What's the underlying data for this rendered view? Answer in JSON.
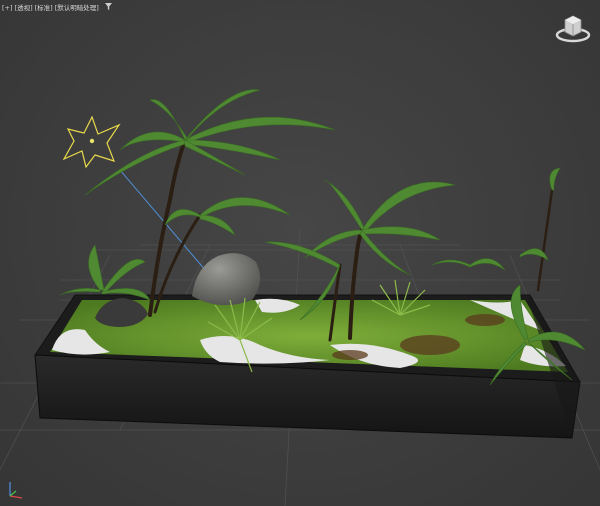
{
  "viewport": {
    "label_items": [
      "[+]",
      "[透视]",
      "[标准]",
      "[默认明暗处理]"
    ],
    "filter_icon": "funnel-icon",
    "viewcube_icon": "viewcube-home-icon",
    "axis_icon": "axis-tripod-icon",
    "scene_object": "fern-planter-model",
    "selected_light": "sun-light-helper"
  },
  "colors": {
    "viewport_bg": "#3c3c3c",
    "grid_line": "#5a5a5a",
    "light_helper": "#e8d94a",
    "light_target_line": "#4f8fd8",
    "planter": "#1e1e1e",
    "moss": "#6a9a2c",
    "pebbles": "#e6e6e6",
    "fern": "#4f8a32"
  }
}
